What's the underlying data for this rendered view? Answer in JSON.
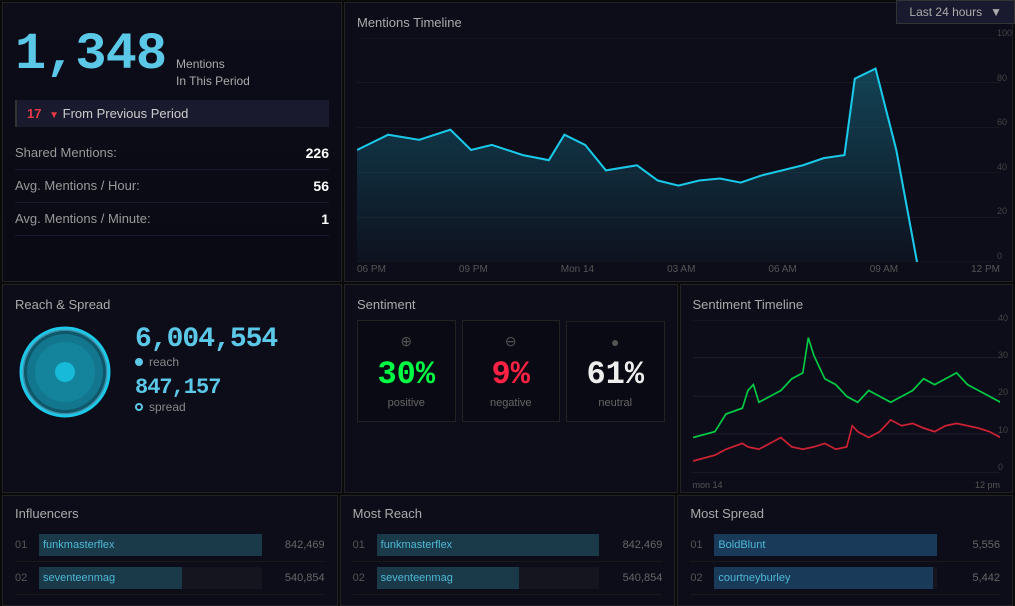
{
  "topbar": {
    "label": "Last 24 hours",
    "dropdown_icon": "▼"
  },
  "mentions_summary": {
    "count": "1,348",
    "period_label_line1": "Mentions",
    "period_label_line2": "In This Period",
    "previous_number": "17",
    "previous_arrow": "▼",
    "previous_text": "From Previous Period",
    "shared_label": "Shared Mentions:",
    "shared_value": "226",
    "avg_hour_label": "Avg. Mentions / Hour:",
    "avg_hour_value": "56",
    "avg_min_label": "Avg. Mentions / Minute:",
    "avg_min_value": "1"
  },
  "mentions_timeline": {
    "title": "Mentions Timeline",
    "x_labels": [
      "06 PM",
      "09 PM",
      "Mon 14",
      "03 AM",
      "06 AM",
      "09 AM",
      "12 PM"
    ],
    "y_labels": [
      "100",
      "80",
      "60",
      "40",
      "20",
      "0"
    ]
  },
  "reach_spread": {
    "title": "Reach & Spread",
    "reach_value": "6,004,554",
    "reach_label": "reach",
    "spread_value": "847,157",
    "spread_label": "spread"
  },
  "sentiment": {
    "title": "Sentiment",
    "positive_pct": "30%",
    "positive_label": "positive",
    "positive_icon": "+",
    "negative_pct": "9%",
    "negative_label": "negative",
    "negative_icon": "-",
    "neutral_pct": "61%",
    "neutral_label": "neutral",
    "neutral_icon": "●"
  },
  "sentiment_timeline": {
    "title": "Sentiment Timeline",
    "x_labels": [
      "mon 14",
      "12 pm"
    ],
    "y_labels": [
      "40",
      "30",
      "20",
      "10",
      "0"
    ]
  },
  "influencers": {
    "title": "Influencers",
    "items": [
      {
        "rank": "01",
        "name": "funkmasterflex",
        "value": "842,469",
        "pct": 100
      },
      {
        "rank": "02",
        "name": "seventeenmag",
        "value": "540,854",
        "pct": 64
      }
    ]
  },
  "most_reach": {
    "title": "Most Reach",
    "items": [
      {
        "rank": "01",
        "name": "funkmasterflex",
        "value": "842,469",
        "pct": 100
      },
      {
        "rank": "02",
        "name": "seventeenmag",
        "value": "540,854",
        "pct": 64
      }
    ]
  },
  "most_spread": {
    "title": "Most Spread",
    "items": [
      {
        "rank": "01",
        "name": "BoldBlunt",
        "value": "5,556",
        "pct": 100
      },
      {
        "rank": "02",
        "name": "courtneyburley",
        "value": "5,442",
        "pct": 98
      }
    ]
  }
}
